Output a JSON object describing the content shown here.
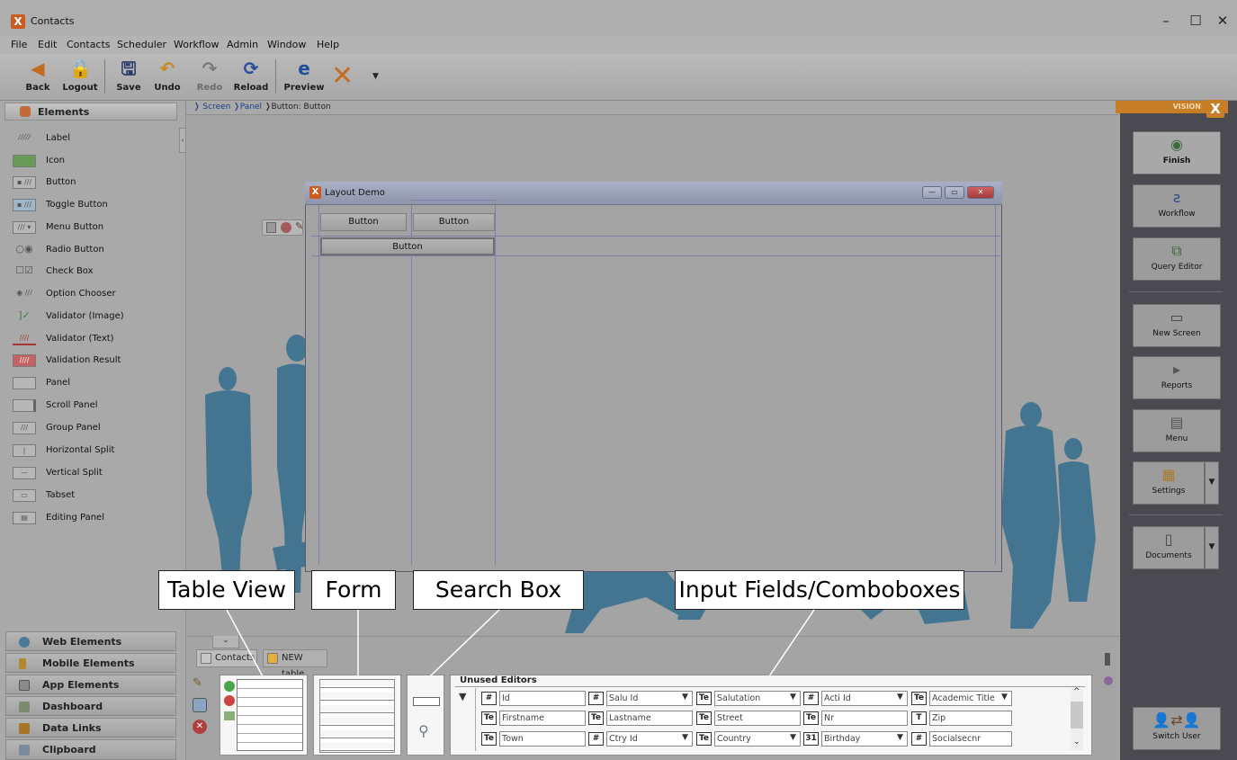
{
  "window": {
    "title": "Contacts",
    "controls": {
      "minimize": "–",
      "maximize": "☐",
      "close": "✕"
    }
  },
  "menu": [
    "File",
    "Edit",
    "Contacts",
    "Scheduler",
    "Workflow",
    "Admin",
    "Window",
    "Help"
  ],
  "toolbar": {
    "back": "Back",
    "logout": "Logout",
    "save": "Save",
    "undo": "Undo",
    "redo": "Redo",
    "reload": "Reload",
    "preview": "Preview"
  },
  "breadcrumb": {
    "screen": "Screen",
    "panel": "Panel",
    "current": "Button: Button"
  },
  "left_panel": {
    "header": "Elements",
    "items": [
      "Label",
      "Icon",
      "Button",
      "Toggle Button",
      "Menu Button",
      "Radio Button",
      "Check Box",
      "Option Chooser",
      "Validator (Image)",
      "Validator (Text)",
      "Validation Result",
      "Panel",
      "Scroll Panel",
      "Group Panel",
      "Horizontal Split",
      "Vertical Split",
      "Tabset",
      "Editing Panel"
    ],
    "categories": [
      "Web Elements",
      "Mobile Elements",
      "App Elements",
      "Dashboard",
      "Data Links",
      "Clipboard"
    ]
  },
  "dialog": {
    "title": "Layout Demo",
    "button1": "Button",
    "button2": "Button",
    "button3": "Button"
  },
  "right_panel": {
    "tab": "VISION",
    "buttons": [
      "Finish",
      "Workflow",
      "Query Editor",
      "New Screen",
      "Reports",
      "Menu",
      "Settings",
      "Documents",
      "Switch User"
    ]
  },
  "bottom": {
    "tabs": [
      "Contacts",
      "NEW table"
    ],
    "unused_editors_title": "Unused Editors",
    "editors": [
      {
        "badge": "#",
        "label": "Id",
        "dropdown": false
      },
      {
        "badge": "#",
        "label": "Salu Id",
        "dropdown": true
      },
      {
        "badge": "Te",
        "label": "Salutation",
        "dropdown": true
      },
      {
        "badge": "#",
        "label": "Acti Id",
        "dropdown": true
      },
      {
        "badge": "Te",
        "label": "Academic Title",
        "dropdown": true
      },
      {
        "badge": "Te",
        "label": "Firstname",
        "dropdown": false
      },
      {
        "badge": "Te",
        "label": "Lastname",
        "dropdown": false
      },
      {
        "badge": "Te",
        "label": "Street",
        "dropdown": false
      },
      {
        "badge": "Te",
        "label": "Nr",
        "dropdown": false
      },
      {
        "badge": "T",
        "label": "Zip",
        "dropdown": false
      },
      {
        "badge": "Te",
        "label": "Town",
        "dropdown": false
      },
      {
        "badge": "#",
        "label": "Ctry Id",
        "dropdown": true
      },
      {
        "badge": "Te",
        "label": "Country",
        "dropdown": true
      },
      {
        "badge": "31",
        "label": "Birthday",
        "dropdown": true
      },
      {
        "badge": "#",
        "label": "Socialsecnr",
        "dropdown": false
      }
    ]
  },
  "callouts": {
    "table_view": "Table View",
    "form": "Form",
    "search_box": "Search Box",
    "input_fields": "Input Fields/Comboboxes"
  }
}
